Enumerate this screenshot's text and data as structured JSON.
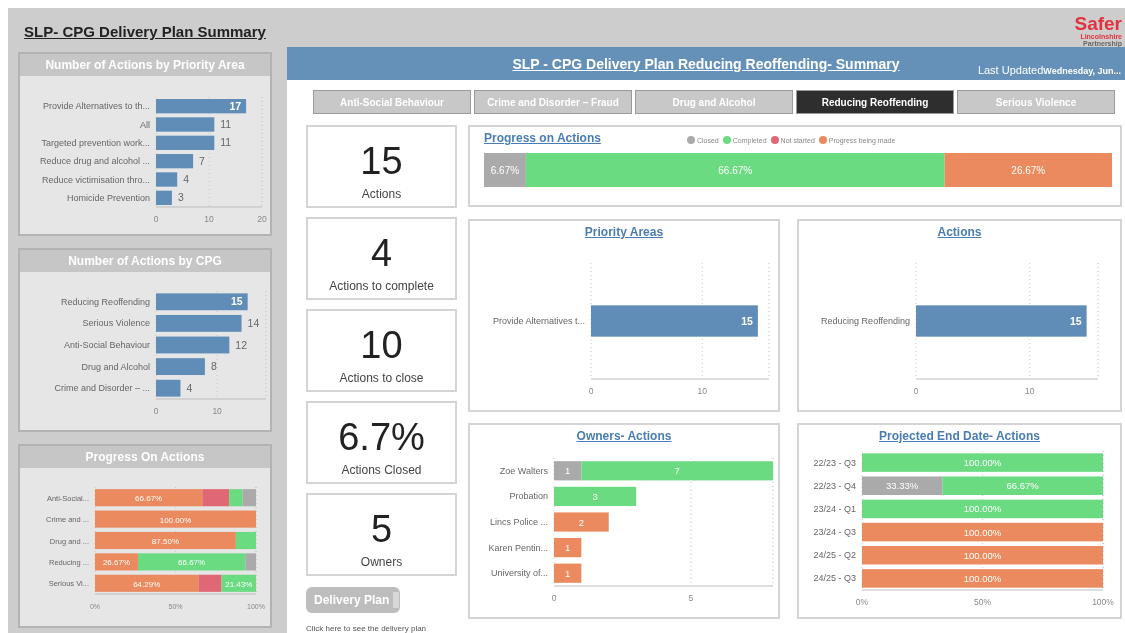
{
  "title": "SLP- CPG Delivery Plan Summary",
  "logo": {
    "name": "Safer",
    "line_2": "Lincolnshire",
    "line_3": "Partnership"
  },
  "side_panels": [
    {
      "chart_data": {
        "type": "bar",
        "orientation": "horizontal",
        "title": "Number of Actions by Priority Area",
        "categories": [
          "Provide Alternatives to th...",
          "All",
          "Targeted prevention work...",
          "Reduce drug and alcohol ...",
          "Reduce victimisation thro...",
          "Homicide Prevention"
        ],
        "xlim": [
          0,
          20
        ],
        "xticks": [
          0,
          10,
          20
        ],
        "data_labels": true,
        "series": [
          {
            "color": "#5f8db8",
            "values": [
              17,
              11,
              11,
              7,
              4,
              3
            ]
          }
        ]
      }
    },
    {
      "chart_data": {
        "type": "bar",
        "orientation": "horizontal",
        "title": "Number of Actions by CPG",
        "categories": [
          "Reducing Reoffending",
          "Serious Violence",
          "Anti-Social Behaviour",
          "Drug and Alcohol",
          "Crime and Disorder – ..."
        ],
        "xlim": [
          0,
          18
        ],
        "xticks": [
          0,
          10
        ],
        "data_labels": true,
        "series": [
          {
            "color": "#5f8db8",
            "values": [
              15,
              14,
              12,
              8,
              4
            ]
          }
        ]
      }
    },
    {
      "chart_data": {
        "type": "bar",
        "orientation": "horizontal",
        "stacked": true,
        "title": "Progress On Actions",
        "categories": [
          "Anti-Social...",
          "Crime and ...",
          "Drug and ...",
          "Reducing ...",
          "Serious Vi..."
        ],
        "xlim": [
          0,
          100
        ],
        "xticks": [
          {
            "value": 0,
            "label": "0%"
          },
          {
            "value": 50,
            "label": "50%"
          },
          {
            "value": 100,
            "label": "100%"
          }
        ],
        "series": [
          {
            "color": "#eb8a5e",
            "values": [
              66.67,
              100,
              87.5,
              26.67,
              64.29
            ],
            "value_labels": [
              "66.67%",
              "100.00%",
              "87.50%",
              "26.67%",
              "64.29%"
            ]
          },
          {
            "color": "#e06774",
            "values": [
              16.67,
              null,
              null,
              null,
              14.29
            ],
            "value_labels": [
              null,
              null,
              null,
              null,
              null
            ]
          },
          {
            "color": "#6bdb82",
            "values": [
              8.33,
              null,
              12.5,
              66.67,
              21.43
            ],
            "value_labels": [
              null,
              null,
              null,
              "66.67%",
              "21.43%"
            ]
          },
          {
            "color": "#aaaaaa",
            "values": [
              8.33,
              null,
              null,
              6.67,
              null
            ],
            "value_labels": [
              null,
              null,
              null,
              null,
              null
            ]
          }
        ]
      }
    }
  ],
  "header": {
    "title": "SLP - CPG Delivery Plan Reducing Reoffending- Summary",
    "last_updated_label": "Last Updated",
    "last_updated_value": "Wednesday, Jun..."
  },
  "tabs": [
    {
      "label": "Anti-Social Behaviour",
      "selected": false
    },
    {
      "label": "Crime and Disorder – Fraud",
      "selected": false
    },
    {
      "label": "Drug and Alcohol",
      "selected": false
    },
    {
      "label": "Reducing Reoffending",
      "selected": true
    },
    {
      "label": "Serious Violence",
      "selected": false
    }
  ],
  "kpis": [
    {
      "value": "15",
      "label": "Actions"
    },
    {
      "value": "4",
      "label": "Actions to complete"
    },
    {
      "value": "10",
      "label": "Actions to close"
    },
    {
      "value": "6.7%",
      "label": "Actions Closed"
    },
    {
      "value": "5",
      "label": "Owners"
    }
  ],
  "delivery_plan": {
    "button": "Delivery Plan",
    "hint": "Click here to see the delivery plan"
  },
  "progress": {
    "chart_data": {
      "type": "bar",
      "orientation": "horizontal",
      "stacked": true,
      "title": "Progress on Actions",
      "legend": true,
      "categories": [
        null
      ],
      "series": [
        {
          "name": "Closed",
          "color": "#aaaaaa",
          "values": [
            6.67
          ],
          "value_labels": [
            "6.67%"
          ]
        },
        {
          "name": "Completed",
          "color": "#6bdb82",
          "values": [
            66.67
          ],
          "value_labels": [
            "66.67%"
          ]
        },
        {
          "name": "Not started",
          "color": "#e06774",
          "values": [
            null
          ],
          "value_labels": [
            null
          ]
        },
        {
          "name": "Progress being made",
          "color": "#eb8a5e",
          "values": [
            26.67
          ],
          "value_labels": [
            "26.67%"
          ]
        }
      ]
    }
  },
  "priority_areas": {
    "chart_data": {
      "type": "bar",
      "orientation": "horizontal",
      "title": "Priority Areas",
      "categories": [
        "Provide Alternatives t..."
      ],
      "xlim": [
        0,
        16
      ],
      "xticks": [
        0,
        10
      ],
      "data_labels": true,
      "series": [
        {
          "color": "#5f8db8",
          "values": [
            15
          ]
        }
      ]
    }
  },
  "actions": {
    "chart_data": {
      "type": "bar",
      "orientation": "horizontal",
      "title": "Actions",
      "categories": [
        "Reducing Reoffending"
      ],
      "xlim": [
        0,
        16
      ],
      "xticks": [
        0,
        10
      ],
      "data_labels": true,
      "series": [
        {
          "color": "#5f8db8",
          "values": [
            15
          ]
        }
      ]
    }
  },
  "owners": {
    "chart_data": {
      "type": "bar",
      "orientation": "horizontal",
      "stacked": true,
      "title": "Owners- Actions",
      "categories": [
        "Zoe Walters",
        "Probation",
        "Lincs Police ...",
        "Karen Pentin...",
        "University of..."
      ],
      "xlim": [
        0,
        8
      ],
      "xticks": [
        0,
        5
      ],
      "data_labels": true,
      "series": [
        {
          "color": "#aaaaaa",
          "values": [
            1,
            null,
            null,
            null,
            null
          ]
        },
        {
          "color": "#6bdb82",
          "values": [
            7,
            3,
            null,
            null,
            null
          ]
        },
        {
          "color": "#eb8a5e",
          "values": [
            null,
            null,
            2,
            1,
            1
          ]
        }
      ]
    }
  },
  "projected_end_date": {
    "chart_data": {
      "type": "bar",
      "orientation": "horizontal",
      "stacked": true,
      "title": "Projected End Date- Actions",
      "categories": [
        "22/23 - Q3",
        "22/23 - Q4",
        "23/24 - Q1",
        "23/24 - Q3",
        "24/25 - Q2",
        "24/25 - Q3"
      ],
      "xlim": [
        0,
        100
      ],
      "xticks": [
        {
          "value": 0,
          "label": "0%"
        },
        {
          "value": 50,
          "label": "50%"
        },
        {
          "value": 100,
          "label": "100%"
        }
      ],
      "series": [
        {
          "color": "#aaaaaa",
          "values": [
            null,
            33.33,
            null,
            null,
            null,
            null
          ],
          "value_labels": [
            null,
            "33.33%",
            null,
            null,
            null,
            null
          ]
        },
        {
          "color": "#6bdb82",
          "values": [
            100,
            66.67,
            100,
            null,
            null,
            null
          ],
          "value_labels": [
            "100.00%",
            "66.67%",
            "100.00%",
            null,
            null,
            null
          ]
        },
        {
          "color": "#eb8a5e",
          "values": [
            null,
            null,
            null,
            100,
            100,
            100
          ],
          "value_labels": [
            null,
            null,
            null,
            "100.00%",
            "100.00%",
            "100.00%"
          ]
        }
      ]
    }
  }
}
